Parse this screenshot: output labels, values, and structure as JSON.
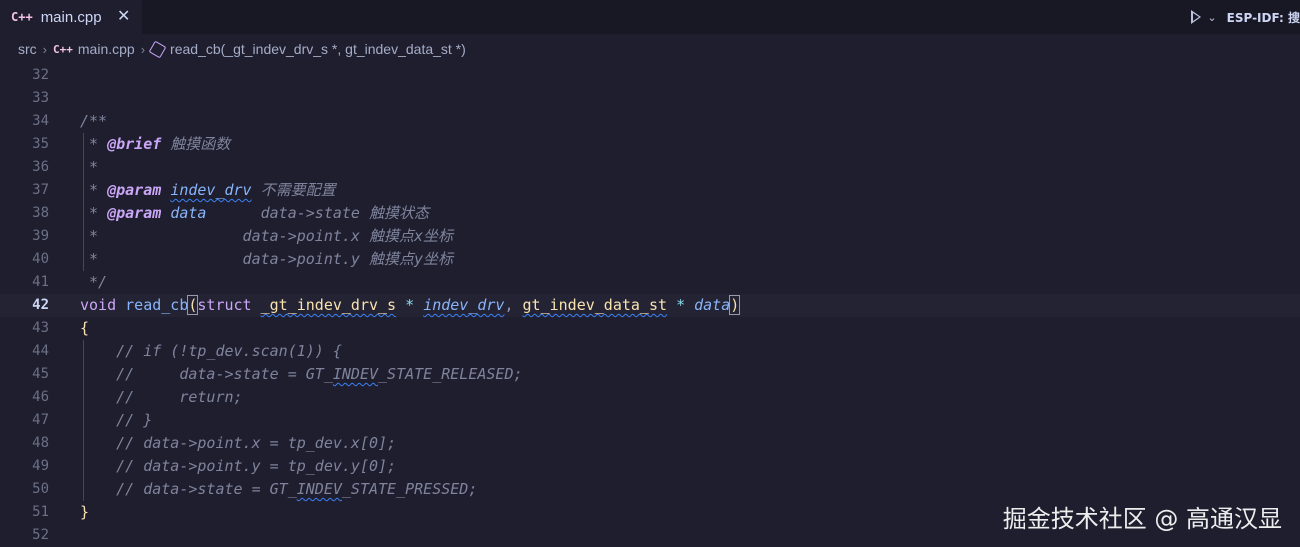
{
  "tabs": [
    {
      "icon": "cpp-file-icon",
      "icon_text": "C++",
      "label": "main.cpp",
      "close": "✕",
      "active": true
    }
  ],
  "actions": {
    "chevron": "⌄",
    "esp_idf_label": "ESP-IDF: 搜"
  },
  "breadcrumb": {
    "folder": "src",
    "file": "main.cpp",
    "symbol": "read_cb(_gt_indev_drv_s *, gt_indev_data_st *)"
  },
  "editor": {
    "active_line": 42,
    "lines": [
      {
        "num": "32",
        "tokens": []
      },
      {
        "num": "33",
        "tokens": []
      },
      {
        "num": "34",
        "tokens": [
          {
            "t": "/**",
            "c": "c-com"
          }
        ]
      },
      {
        "num": "35",
        "tokens": [
          {
            "t": " * ",
            "c": "c-com"
          },
          {
            "t": "@brief",
            "c": "c-tag"
          },
          {
            "t": " 触摸函数",
            "c": "c-com"
          }
        ]
      },
      {
        "num": "36",
        "tokens": [
          {
            "t": " *",
            "c": "c-com"
          }
        ]
      },
      {
        "num": "37",
        "tokens": [
          {
            "t": " * ",
            "c": "c-com"
          },
          {
            "t": "@param",
            "c": "c-tag"
          },
          {
            "t": " ",
            "c": "c-com"
          },
          {
            "t": "indev_drv",
            "c": "c-par sq"
          },
          {
            "t": " 不需要配置",
            "c": "c-com"
          }
        ]
      },
      {
        "num": "38",
        "tokens": [
          {
            "t": " * ",
            "c": "c-com"
          },
          {
            "t": "@param",
            "c": "c-tag"
          },
          {
            "t": " ",
            "c": "c-com"
          },
          {
            "t": "data",
            "c": "c-par"
          },
          {
            "t": "      data->state 触摸状态",
            "c": "c-com"
          }
        ]
      },
      {
        "num": "39",
        "tokens": [
          {
            "t": " *                data->point.x 触摸点x坐标",
            "c": "c-com"
          }
        ]
      },
      {
        "num": "40",
        "tokens": [
          {
            "t": " *                data->point.y 触摸点y坐标",
            "c": "c-com"
          }
        ]
      },
      {
        "num": "41",
        "tokens": [
          {
            "t": " */",
            "c": "c-com"
          }
        ]
      },
      {
        "num": "42",
        "tokens": [
          {
            "t": "void",
            "c": "c-kw"
          },
          {
            "t": " ",
            "c": "c-id"
          },
          {
            "t": "read_cb",
            "c": "c-fn"
          },
          {
            "t": "(",
            "c": "c-brk"
          },
          {
            "t": "struct",
            "c": "c-kw"
          },
          {
            "t": " ",
            "c": "c-id"
          },
          {
            "t": "_gt_indev_drv_s",
            "c": "c-ty sq"
          },
          {
            "t": " ",
            "c": "c-id"
          },
          {
            "t": "*",
            "c": "c-op"
          },
          {
            "t": " ",
            "c": "c-id"
          },
          {
            "t": "indev_drv",
            "c": "c-par sq"
          },
          {
            "t": ", ",
            "c": "c-pn"
          },
          {
            "t": "gt_indev_data_st",
            "c": "c-ty sq"
          },
          {
            "t": " ",
            "c": "c-id"
          },
          {
            "t": "*",
            "c": "c-op"
          },
          {
            "t": " ",
            "c": "c-id"
          },
          {
            "t": "data",
            "c": "c-par"
          },
          {
            "t": ")",
            "c": "c-brk"
          }
        ]
      },
      {
        "num": "43",
        "tokens": [
          {
            "t": "{",
            "c": "c-br"
          }
        ]
      },
      {
        "num": "44",
        "tokens": [
          {
            "t": "    // if (!tp_dev.scan(1)) {",
            "c": "c-com"
          }
        ]
      },
      {
        "num": "45",
        "tokens": [
          {
            "t": "    //     data->state = GT_",
            "c": "c-com"
          },
          {
            "t": "INDEV",
            "c": "c-com sq"
          },
          {
            "t": "_STATE_RELEASED;",
            "c": "c-com"
          }
        ]
      },
      {
        "num": "46",
        "tokens": [
          {
            "t": "    //     return;",
            "c": "c-com"
          }
        ]
      },
      {
        "num": "47",
        "tokens": [
          {
            "t": "    // }",
            "c": "c-com"
          }
        ]
      },
      {
        "num": "48",
        "tokens": [
          {
            "t": "    // data->point.x = tp_dev.x[0];",
            "c": "c-com"
          }
        ]
      },
      {
        "num": "49",
        "tokens": [
          {
            "t": "    // data->point.y = tp_dev.y[0];",
            "c": "c-com"
          }
        ]
      },
      {
        "num": "50",
        "tokens": [
          {
            "t": "    // data->state = GT_",
            "c": "c-com"
          },
          {
            "t": "INDEV",
            "c": "c-com sq"
          },
          {
            "t": "_STATE_PRESSED;",
            "c": "c-com"
          }
        ]
      },
      {
        "num": "51",
        "tokens": [
          {
            "t": "}",
            "c": "c-br"
          }
        ]
      },
      {
        "num": "52",
        "tokens": []
      }
    ]
  },
  "watermark": "掘金技术社区 @ 高通汉显"
}
